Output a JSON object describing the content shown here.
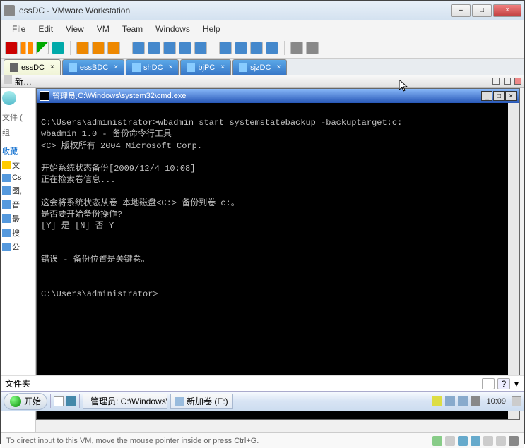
{
  "window": {
    "title": "essDC - VMware Workstation",
    "controls": {
      "min": "–",
      "max": "□",
      "close": "×"
    }
  },
  "menu": {
    "file": "File",
    "edit": "Edit",
    "view": "View",
    "vm": "VM",
    "team": "Team",
    "windows": "Windows",
    "help": "Help"
  },
  "vm_tabs": [
    {
      "name": "essDC",
      "active": true
    },
    {
      "name": "essBDC",
      "active": false
    },
    {
      "name": "shDC",
      "active": false
    },
    {
      "name": "bjPC",
      "active": false
    },
    {
      "name": "sjzDC",
      "active": false
    }
  ],
  "guest_top": {
    "label": "新…"
  },
  "guest_left": {
    "text1": "文件 (",
    "text2": "组",
    "fav": "收藏",
    "items": [
      "文",
      "Cs",
      "图,",
      "音",
      "最",
      "搜",
      "公"
    ]
  },
  "cmd": {
    "title_prefix": "管理员: ",
    "title_path": "C:\\Windows\\system32\\cmd.exe",
    "body": "\nC:\\Users\\administrator>wbadmin start systemstatebackup -backuptarget:c:\nwbadmin 1.0 - 备份命令行工具\n<C> 版权所有 2004 Microsoft Corp.\n\n开始系统状态备份[2009/12/4 10:08]\n正在检索卷信息...\n\n这会将系统状态从卷 本地磁盘<C:> 备份到卷 c:。\n是否要开始备份操作?\n[Y] 是 [N] 否 Y\n\n\n错误 - 备份位置是关键卷。\n\n\nC:\\Users\\administrator>"
  },
  "bottombar": {
    "label": "文件夹"
  },
  "taskbar": {
    "start": "开始",
    "task_cmd": "管理员: C:\\Windows\\…",
    "task_vol": "新加卷 (E:)",
    "clock": "10:09"
  },
  "host_status": {
    "text": "To direct input to this VM, move the mouse pointer inside or press Ctrl+G."
  }
}
